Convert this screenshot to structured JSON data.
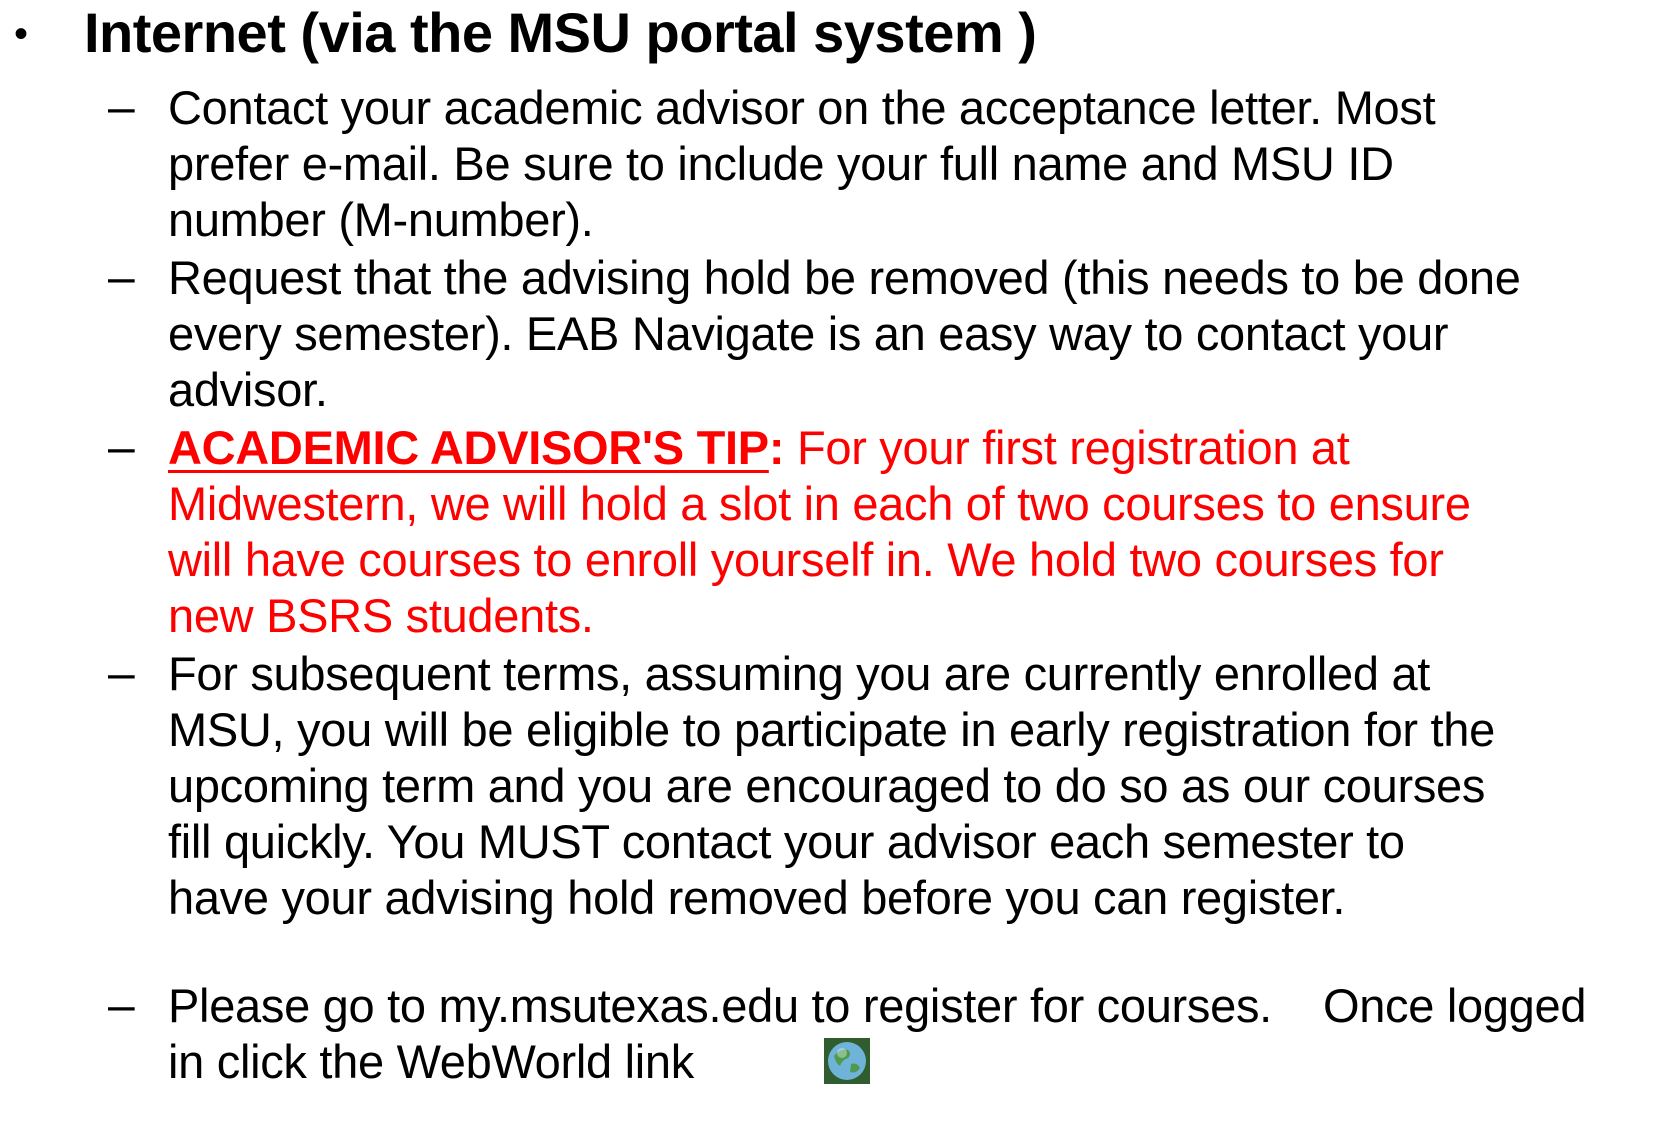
{
  "bullet": {
    "marker": "•",
    "heading": "Internet (via the MSU portal system )"
  },
  "items": [
    {
      "marker": "–",
      "text": "Contact your academic advisor on the acceptance letter. Most prefer e-mail. Be sure to include your full name and MSU ID number (M-number)."
    },
    {
      "marker": "–",
      "text": "Request that the advising hold be removed (this needs to be done every semester). EAB Navigate is an easy way to contact your advisor."
    },
    {
      "marker": "–",
      "tip_label": "ACADEMIC ADVISOR'S TIP",
      "tip_colon": ":",
      "text": " For your first registration at Midwestern, we will hold a slot in each of two courses to ensure will have courses to enroll yourself in. We hold two courses for new BSRS students."
    },
    {
      "marker": "–",
      "text": "For subsequent terms, assuming you are currently enrolled at MSU, you will be eligible to participate in early registration for the upcoming term and you are encouraged to do so as our courses fill quickly. You MUST contact your advisor each semester to have your advising hold removed before you can register."
    },
    {
      "marker": "–",
      "text": "Please go to my.msutexas.edu to register for courses.    Once logged in click the WebWorld link",
      "icon": "globe-icon"
    }
  ],
  "colors": {
    "text": "#000000",
    "tip": "#ff0000"
  }
}
